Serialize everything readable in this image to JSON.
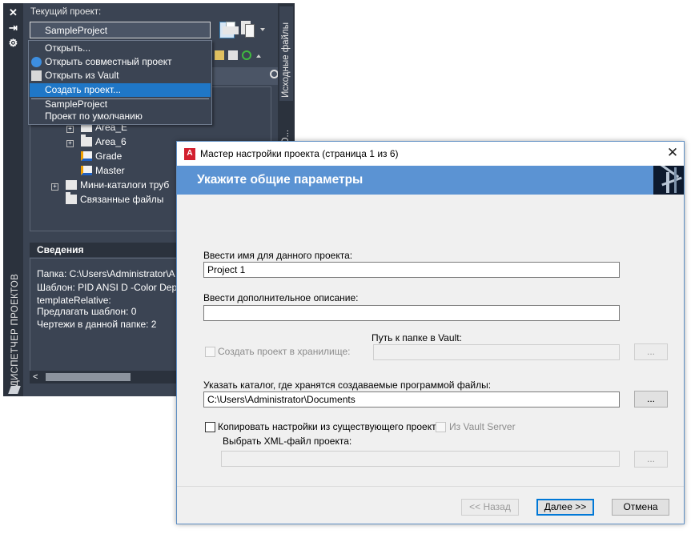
{
  "palette": {
    "title_vertical": "ДИСПЕТЧЕР ПРОЕКТОВ",
    "current_project_label": "Текущий проект:",
    "current_project_value": "SampleProject",
    "side_tabs": [
      "Исходные файлы",
      "ный D..."
    ],
    "tree": {
      "items": [
        "Area_E",
        "Area_6",
        "Grade",
        "Master",
        "Мини-каталоги труб",
        "Связанные файлы"
      ]
    },
    "details": {
      "header": "Сведения",
      "lines": [
        "Папка:  C:\\Users\\Administrator\\A",
        "Шаблон: PID ANSI D -Color Dep",
        "templateRelative:",
        "Предлагать шаблон: 0",
        "Чертежи в данной папке: 2"
      ]
    }
  },
  "dropdown": {
    "items": [
      "Открыть...",
      "Открыть совместный проект",
      "Открыть из Vault",
      "Создать проект...",
      "SampleProject",
      "Проект по умолчанию"
    ],
    "highlighted_index": 3
  },
  "wizard": {
    "title": "Мастер настройки проекта (страница 1 из 6)",
    "heading": "Укажите общие параметры",
    "name_label": "Ввести имя для данного проекта:",
    "name_value": "Project 1",
    "description_label": "Ввести дополнительное описание:",
    "description_value": "",
    "vault_path_label": "Путь к папке в Vault:",
    "create_in_vault_label": "Создать проект в хранилище:",
    "browse_label": "...",
    "folder_label": "Указать каталог, где хранятся создаваемые программой файлы:",
    "folder_value": "C:\\Users\\Administrator\\Documents",
    "copy_settings_label": "Копировать настройки из существующего проекта",
    "from_vault_server_label": "Из Vault Server",
    "xml_label": "Выбрать XML-файл проекта:",
    "back_button": "<< Назад",
    "next_button": "Далее >>",
    "cancel_button": "Отмена"
  },
  "colors": {
    "palette_bg": "#3b4453",
    "palette_dark": "#2b323d",
    "menu_highlight": "#1f77c7",
    "wizard_header": "#5b93d3"
  }
}
